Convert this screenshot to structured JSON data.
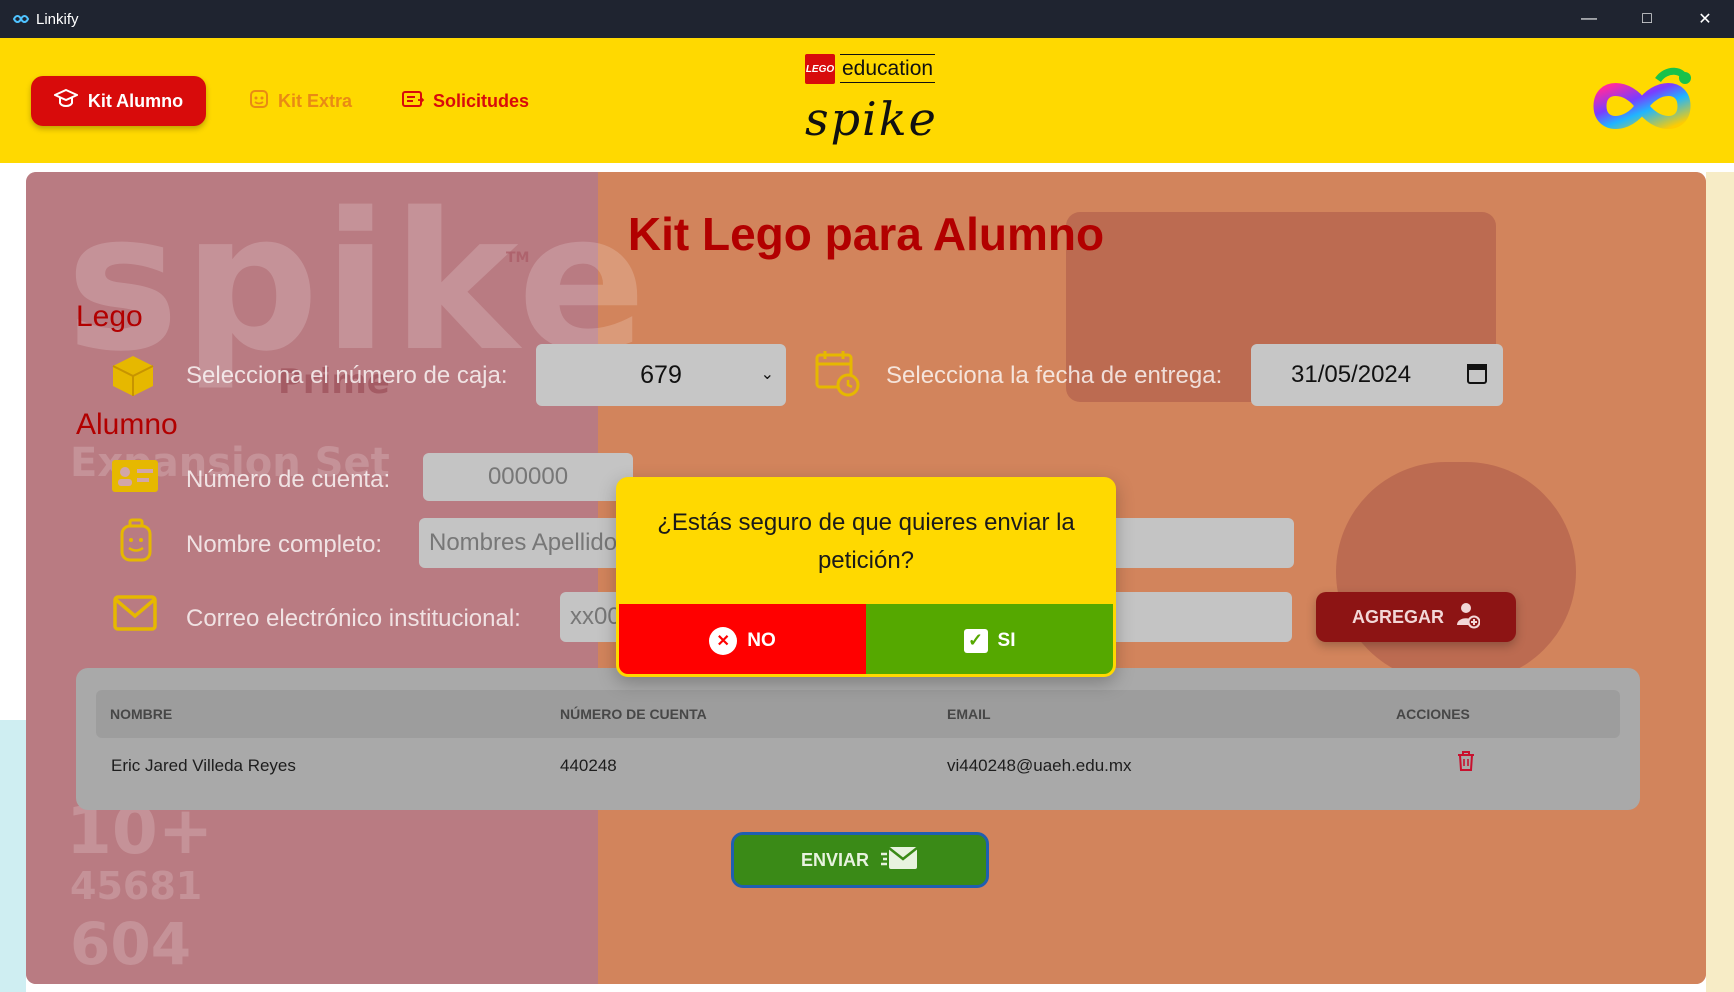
{
  "window": {
    "title": "Linkify"
  },
  "nav": {
    "kit_alumno": "Kit Alumno",
    "kit_extra": "Kit Extra",
    "solicitudes": "Solicitudes"
  },
  "brand": {
    "lego": "LEGO",
    "education": "education",
    "spike": "spike"
  },
  "page": {
    "title": "Kit Lego para Alumno"
  },
  "lego_section": {
    "label": "Lego",
    "box_label": "Selecciona el número de caja:",
    "box_value": "679",
    "date_label": "Selecciona la fecha de entrega:",
    "date_value": "31/05/2024"
  },
  "alumno_section": {
    "label": "Alumno",
    "account_label": "Número de cuenta:",
    "account_placeholder": "000000",
    "name_label": "Nombre completo:",
    "name_placeholder": "Nombres Apellidos",
    "email_label": "Correo electrónico institucional:",
    "email_placeholder": "xx000000@uaeh.edu.mx",
    "add_button": "AGREGAR"
  },
  "table": {
    "headers": [
      "NOMBRE",
      "NÚMERO DE CUENTA",
      "EMAIL",
      "ACCIONES"
    ],
    "rows": [
      {
        "name": "Eric Jared Villeda Reyes",
        "account": "440248",
        "email": "vi440248@uaeh.edu.mx"
      }
    ]
  },
  "send_button": "ENVIAR",
  "dialog": {
    "question": "¿Estás seguro de que quieres enviar la petición?",
    "no": "NO",
    "yes": "SI"
  },
  "background_text": {
    "spike": "spike",
    "tm": "TM",
    "prime": "Prime",
    "expansion": "Expansion Set",
    "age": "10+",
    "set_number": "45681",
    "pieces": "604"
  },
  "colors": {
    "header_yellow": "#ffd900",
    "brand_red": "#d80b0b",
    "accent_orange": "#e98a14",
    "confirm_green": "#55a800",
    "cancel_red": "#ff0000"
  }
}
